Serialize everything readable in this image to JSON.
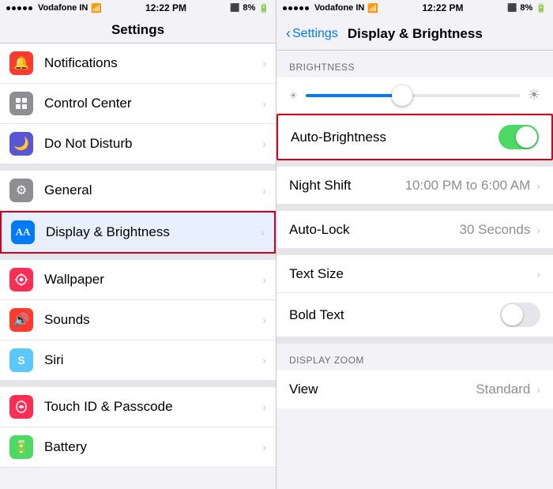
{
  "left_status": {
    "carrier": "Vodafone IN",
    "time": "12:22 PM",
    "battery": "8%"
  },
  "right_status": {
    "carrier": "Vodafone IN",
    "time": "12:22 PM",
    "battery": "8%"
  },
  "left_panel": {
    "title": "Settings",
    "items": [
      {
        "id": "notifications",
        "label": "Notifications",
        "icon_color": "#ff3b30",
        "icon": "🔔"
      },
      {
        "id": "control-center",
        "label": "Control Center",
        "icon_color": "#8e8e93",
        "icon": "⊞"
      },
      {
        "id": "do-not-disturb",
        "label": "Do Not Disturb",
        "icon_color": "#5856d6",
        "icon": "🌙"
      },
      {
        "id": "general",
        "label": "General",
        "icon_color": "#8e8e93",
        "icon": "⚙"
      },
      {
        "id": "display-brightness",
        "label": "Display & Brightness",
        "icon_color": "#007aff",
        "icon": "AA",
        "highlighted": true
      },
      {
        "id": "wallpaper",
        "label": "Wallpaper",
        "icon_color": "#ff2d55",
        "icon": "❀"
      },
      {
        "id": "sounds",
        "label": "Sounds",
        "icon_color": "#ff3b30",
        "icon": "🔊"
      },
      {
        "id": "siri",
        "label": "Siri",
        "icon_color": "#5ac8fa",
        "icon": "S"
      },
      {
        "id": "touch-id",
        "label": "Touch ID & Passcode",
        "icon_color": "#ff2d55",
        "icon": "👁"
      },
      {
        "id": "battery",
        "label": "Battery",
        "icon_color": "#4cd964",
        "icon": "🔋"
      }
    ]
  },
  "right_panel": {
    "back_label": "Settings",
    "title": "Display & Brightness",
    "sections": [
      {
        "header": "BRIGHTNESS",
        "items": []
      }
    ],
    "brightness_value": 45,
    "auto_brightness_label": "Auto-Brightness",
    "auto_brightness_on": true,
    "rows": [
      {
        "id": "night-shift",
        "label": "Night Shift",
        "value": "10:00 PM to 6:00 AM",
        "has_chevron": true
      },
      {
        "id": "auto-lock",
        "label": "Auto-Lock",
        "value": "30 Seconds",
        "has_chevron": true
      }
    ],
    "rows2": [
      {
        "id": "text-size",
        "label": "Text Size",
        "value": "",
        "has_chevron": true
      },
      {
        "id": "bold-text",
        "label": "Bold Text",
        "value": "",
        "has_toggle": true,
        "toggle_on": false
      }
    ],
    "display_zoom_header": "DISPLAY ZOOM",
    "rows3": [
      {
        "id": "view",
        "label": "View",
        "value": "Standard",
        "has_chevron": true
      }
    ]
  }
}
